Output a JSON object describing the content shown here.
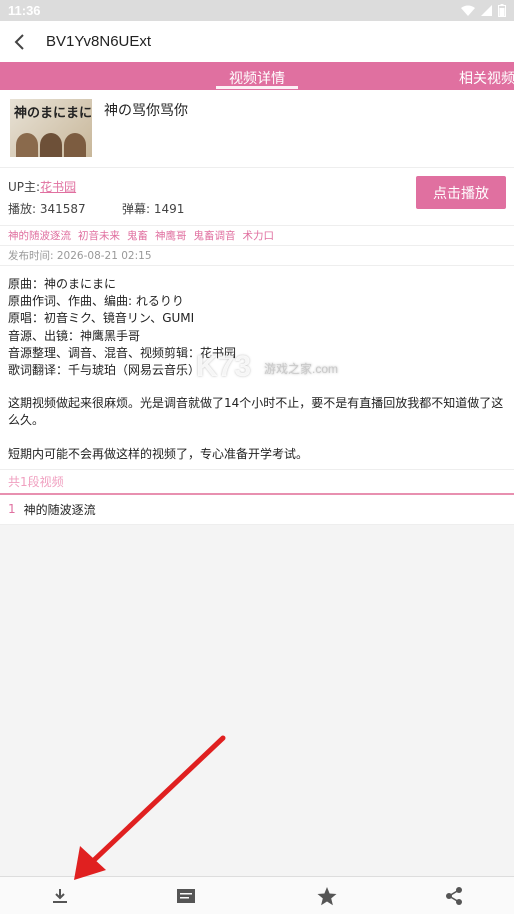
{
  "status": {
    "time": "11:36"
  },
  "appbar": {
    "title": "BV1Yv8N6UExt",
    "back_icon": "chevron-left-icon"
  },
  "tabs": [
    {
      "label": "视频详情",
      "active": true
    },
    {
      "label": "相关视频",
      "active": false
    }
  ],
  "video": {
    "thumb_text": "神のまにまに",
    "title": "神の骂你骂你",
    "up_label": "UP主:",
    "up_name": "花书园",
    "plays_label": "播放: 341587",
    "danmaku_label": "弹幕: 1491",
    "play_button": "点击播放",
    "tags": [
      "神的随波逐流",
      "初音未来",
      "鬼畜",
      "神鹰哥",
      "鬼畜调音",
      "术力口"
    ],
    "publish_time": "发布时间: 2026-08-21 02:15"
  },
  "description": {
    "lines": [
      "原曲：神のまにまに",
      "原曲作词、作曲、编曲: れるりり",
      "原唱：初音ミク、镜音リン、GUMI",
      "音源、出镜：神鹰黑手哥",
      "音源整理、调音、混音、视频剪辑：花书园",
      "歌词翻译：千与琥珀（网易云音乐）"
    ],
    "para1": "这期视频做起来很麻烦。光是调音就做了14个小时不止，要不是有直播回放我都不知道做了这么久。",
    "para2": "短期内可能不会再做这样的视频了，专心准备开学考试。"
  },
  "watermark": {
    "main": "K73",
    "sub": "游戏之家",
    "domain": ".com"
  },
  "segments": {
    "count_label": "共1段视频",
    "items": [
      {
        "num": "1",
        "title": "神的随波逐流"
      }
    ]
  },
  "bottom_bar": {
    "icons": [
      "download-icon",
      "danmaku-icon",
      "star-icon",
      "share-icon"
    ]
  },
  "colors": {
    "accent": "#e070a0",
    "annotation_arrow": "#e02020"
  }
}
